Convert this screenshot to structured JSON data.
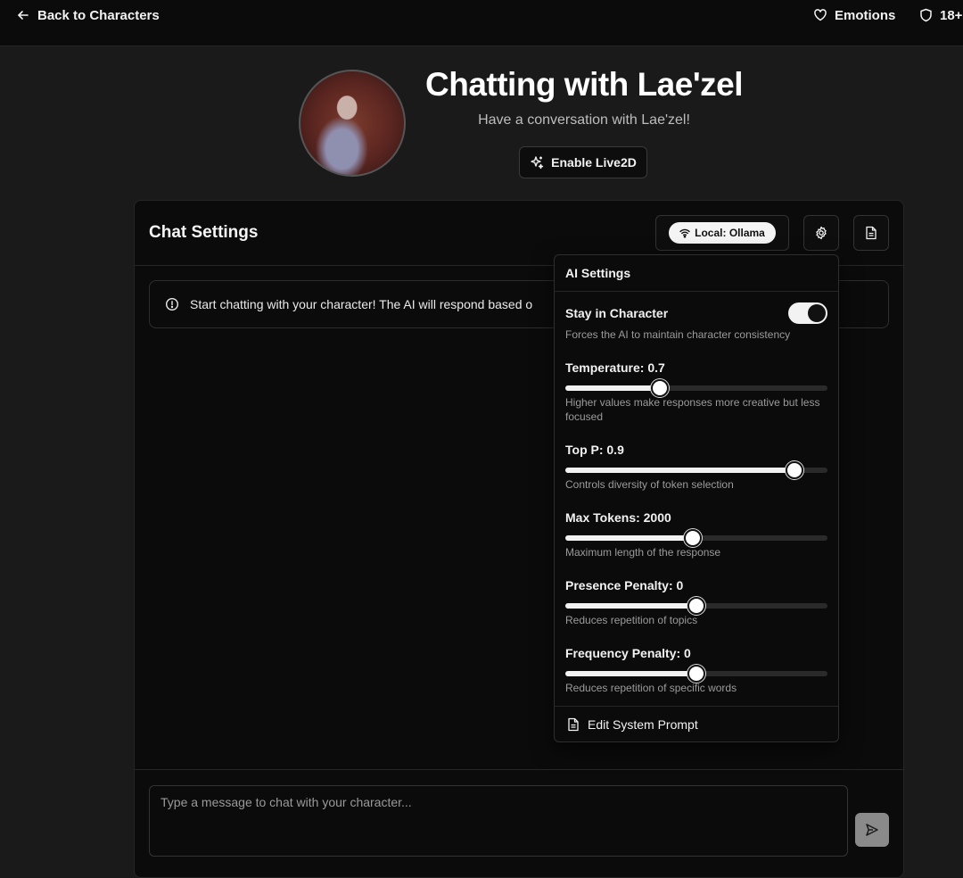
{
  "topbar": {
    "back_label": "Back to Characters",
    "emotions_label": "Emotions",
    "age_rating": "18+"
  },
  "header": {
    "title": "Chatting with Lae'zel",
    "subtitle": "Have a conversation with Lae'zel!",
    "live2d_label": "Enable Live2D"
  },
  "chat_card": {
    "title": "Chat Settings",
    "provider_label": "Local: Ollama",
    "info_text": "Start chatting with your character! The AI will respond based o",
    "input_placeholder": "Type a message to chat with your character..."
  },
  "ai_settings": {
    "title": "AI Settings",
    "stay_in_character": {
      "label": "Stay in Character",
      "description": "Forces the AI to maintain character consistency",
      "enabled": true
    },
    "sliders": [
      {
        "label": "Temperature: 0.7",
        "description": "Higher values make responses more creative but less focused",
        "value": 0.7,
        "level": 0.36
      },
      {
        "label": "Top P: 0.9",
        "description": "Controls diversity of token selection",
        "value": 0.9,
        "level": 0.873
      },
      {
        "label": "Max Tokens: 2000",
        "description": "Maximum length of the response",
        "value": 2000,
        "level": 0.486
      },
      {
        "label": "Presence Penalty: 0",
        "description": "Reduces repetition of topics",
        "value": 0,
        "level": 0.5
      },
      {
        "label": "Frequency Penalty: 0",
        "description": "Reduces repetition of specific words",
        "value": 0,
        "level": 0.5
      }
    ],
    "edit_prompt_label": "Edit System Prompt"
  },
  "colors": {
    "background": "#1a1a1a",
    "surface": "#0b0b0b",
    "border": "#262626",
    "accent": "#f2f2f2"
  },
  "icons": {
    "back": "arrow-left-icon",
    "emotions": "heart-icon",
    "age_rating": "shield-icon",
    "live2d": "sparkles-icon",
    "provider": "wifi-icon",
    "settings": "gear-icon",
    "document": "file-text-icon",
    "info": "info-circle-icon",
    "send": "send-icon"
  }
}
